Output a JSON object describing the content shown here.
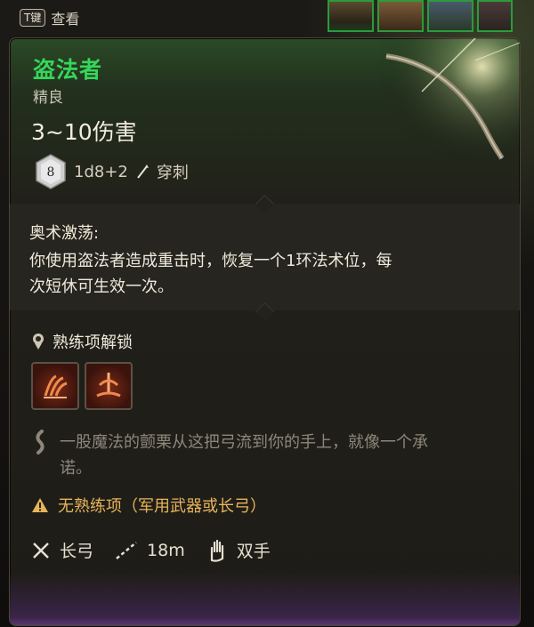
{
  "hint": {
    "key": "T键",
    "label": "查看"
  },
  "item": {
    "name": "盗法者",
    "rarity": "精良",
    "damage": "3~10伤害",
    "dice_face": "8",
    "dice_formula": "1d8+2",
    "damage_type": "穿刺"
  },
  "ability": {
    "name": "奥术激荡:",
    "description_line1": "你使用盗法者造成重击时，恢复一个1环法术位，每",
    "description_line2": "次短休可生效一次。"
  },
  "proficiency": {
    "label": "熟练项解锁",
    "icons": [
      "hamstring-shot-icon",
      "piercing-shot-icon"
    ]
  },
  "flavor": {
    "line1": "一股魔法的颤栗从这把弓流到你的手上，就像一个承",
    "line2": "诺。"
  },
  "warning": "无熟练项（军用武器或长弓）",
  "stats": {
    "weapon_type": "长弓",
    "range": "18m",
    "handedness": "双手"
  },
  "colors": {
    "title": "#36d65a",
    "warning": "#e7b45a",
    "portrait_border": "#2d9a3c"
  }
}
